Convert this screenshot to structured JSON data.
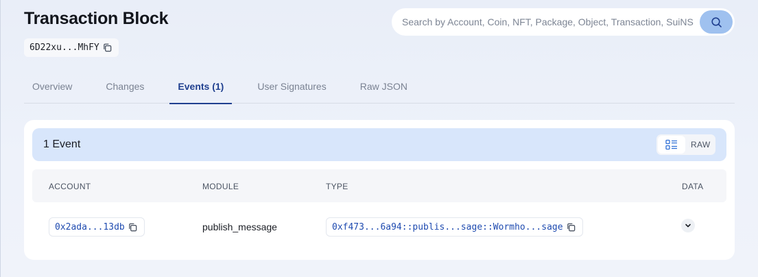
{
  "page": {
    "title": "Transaction Block",
    "digest": "6D22xu...MhFY"
  },
  "search": {
    "placeholder": "Search by Account, Coin, NFT, Package, Object, Transaction, SuiNS"
  },
  "tabs": [
    {
      "label": "Overview",
      "active": false
    },
    {
      "label": "Changes",
      "active": false
    },
    {
      "label": "Events (1)",
      "active": true
    },
    {
      "label": "User Signatures",
      "active": false
    },
    {
      "label": "Raw JSON",
      "active": false
    }
  ],
  "events": {
    "count_label": "1 Event",
    "view_toggle": {
      "list_icon": "list-view-icon",
      "raw_label": "RAW"
    },
    "columns": [
      "ACCOUNT",
      "MODULE",
      "TYPE",
      "DATA"
    ],
    "rows": [
      {
        "account": "0x2ada...13db",
        "module": "publish_message",
        "type": "0xf473...6a94::publis...sage::Wormho...sage"
      }
    ]
  },
  "colors": {
    "accent": "#1f3f8f",
    "link": "#1f4bb0",
    "search_button": "#9fc1ef",
    "events_header_bg": "#d8e6fb"
  },
  "icons": [
    "copy-icon",
    "search-icon",
    "list-view-icon",
    "chevron-down-icon"
  ]
}
